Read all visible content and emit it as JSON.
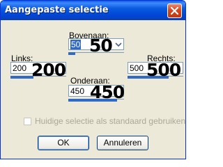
{
  "window": {
    "title": "Aangepaste selectie"
  },
  "fields": {
    "top": {
      "label": "Bovenaan:",
      "value": "50",
      "overlay": "50"
    },
    "left": {
      "label": "Links:",
      "value": "200",
      "overlay": "200"
    },
    "right": {
      "label": "Rechts:",
      "value": "500",
      "overlay": "500"
    },
    "bottom": {
      "label": "Onderaan:",
      "value": "450",
      "overlay": "450"
    }
  },
  "checkbox": {
    "label": "Huidige selectie als standaard gebruiken",
    "checked": false,
    "enabled": false
  },
  "buttons": {
    "ok": "OK",
    "cancel": "Annuleren"
  },
  "icons": {
    "close": "close-icon",
    "spin": "spinner-arrow-icon"
  }
}
